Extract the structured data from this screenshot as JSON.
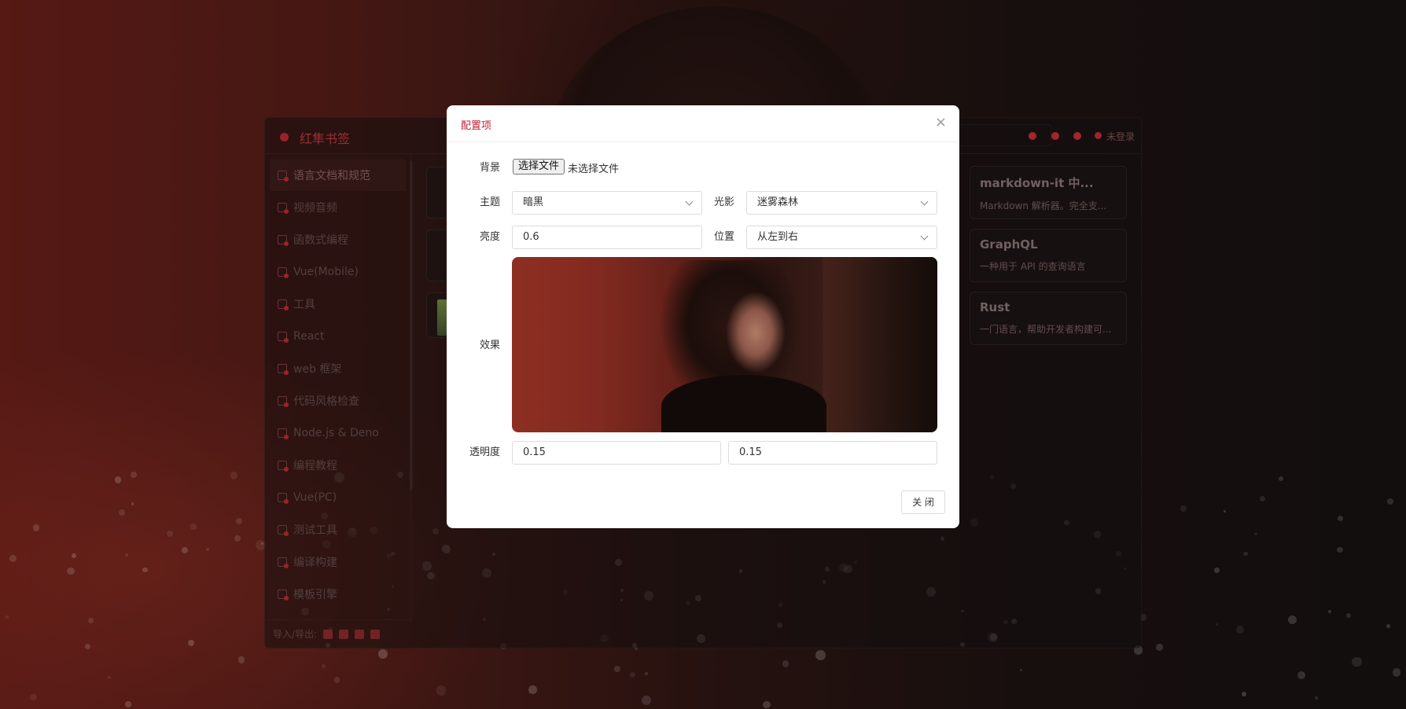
{
  "app": {
    "title": "红隼书签",
    "login": "未登录",
    "sidebar": [
      "语言文档和规范",
      "视频音频",
      "函数式编程",
      "Vue(Mobile)",
      "工具",
      "React",
      "web 框架",
      "代码风格检查",
      "Node.js & Deno",
      "编程教程",
      "Vue(PC)",
      "测试工具",
      "编译构建",
      "模板引擎"
    ],
    "footer_label": "导入/导出:",
    "cards": [
      {
        "title": "markdown-it 中...",
        "desc": "Markdown 解析器。完全支..."
      },
      {
        "title": "GraphQL",
        "desc": "一种用于 API 的查询语言"
      },
      {
        "title": "Rust",
        "desc": "一门语言，帮助开发者构建可..."
      }
    ]
  },
  "modal": {
    "title": "配置项",
    "close_icon": "×",
    "labels": {
      "background": "背景",
      "theme": "主题",
      "light": "光影",
      "brightness": "亮度",
      "position": "位置",
      "effect": "效果",
      "opacity": "透明度"
    },
    "file_button": "选择文件",
    "file_status": "未选择文件",
    "theme_value": "暗黑",
    "light_value": "迷雾森林",
    "brightness_value": "0.6",
    "position_value": "从左到右",
    "opacity_value_1": "0.15",
    "opacity_value_2": "0.15",
    "close_button": "关 闭"
  },
  "colors": {
    "accent": "#c12035",
    "brand": "#a8262c"
  }
}
